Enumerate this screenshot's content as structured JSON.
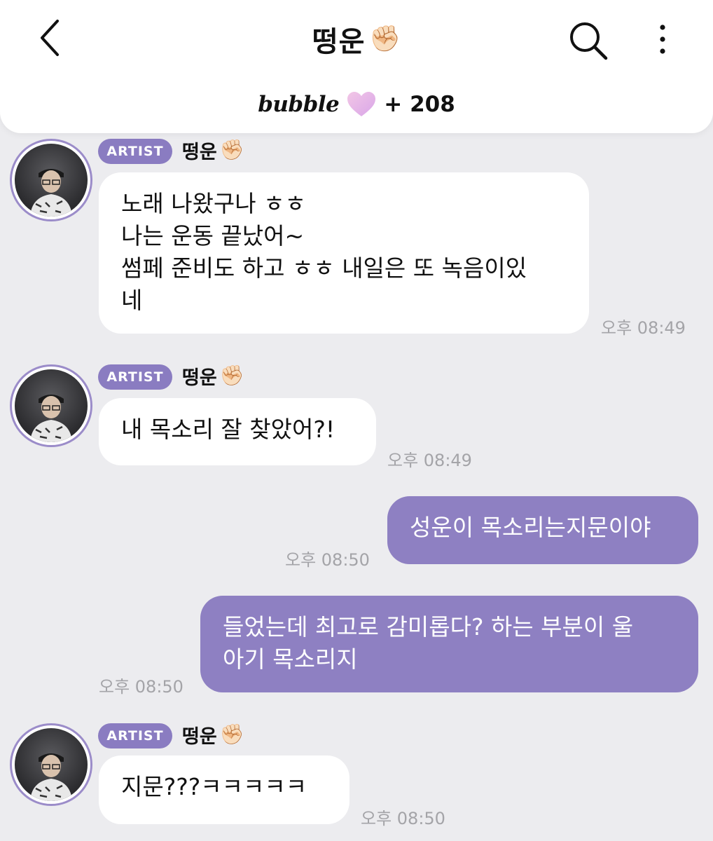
{
  "header": {
    "title": "떵운",
    "title_emoji": "✊🏻",
    "brand": "bubble",
    "count": "+ 208"
  },
  "colors": {
    "accent": "#8a7cc1",
    "outgoing_bubble": "#8e80c2",
    "background": "#ececef"
  },
  "messages": [
    {
      "direction": "in",
      "badge": "ARTIST",
      "sender": "떵운",
      "sender_emoji": "✊🏻",
      "text": "노래 나왔구나 ㅎㅎ\n나는 운동 끝났어~\n썸페 준비도 하고 ㅎㅎ 내일은 또 녹음이있\n네",
      "time": "오후 08:49"
    },
    {
      "direction": "in",
      "badge": "ARTIST",
      "sender": "떵운",
      "sender_emoji": "✊🏻",
      "text": "내 목소리 잘 찾았어?!",
      "time": "오후 08:49"
    },
    {
      "direction": "out",
      "text": "성운이 목소리는지문이야",
      "time": "오후 08:50"
    },
    {
      "direction": "out",
      "text": "들었는데 최고로 감미롭다? 하는 부분이 울\n아기 목소리지",
      "time": "오후 08:50"
    },
    {
      "direction": "in",
      "badge": "ARTIST",
      "sender": "떵운",
      "sender_emoji": "✊🏻",
      "text": "지문???ㅋㅋㅋㅋㅋ",
      "time": "오후 08:50"
    }
  ]
}
